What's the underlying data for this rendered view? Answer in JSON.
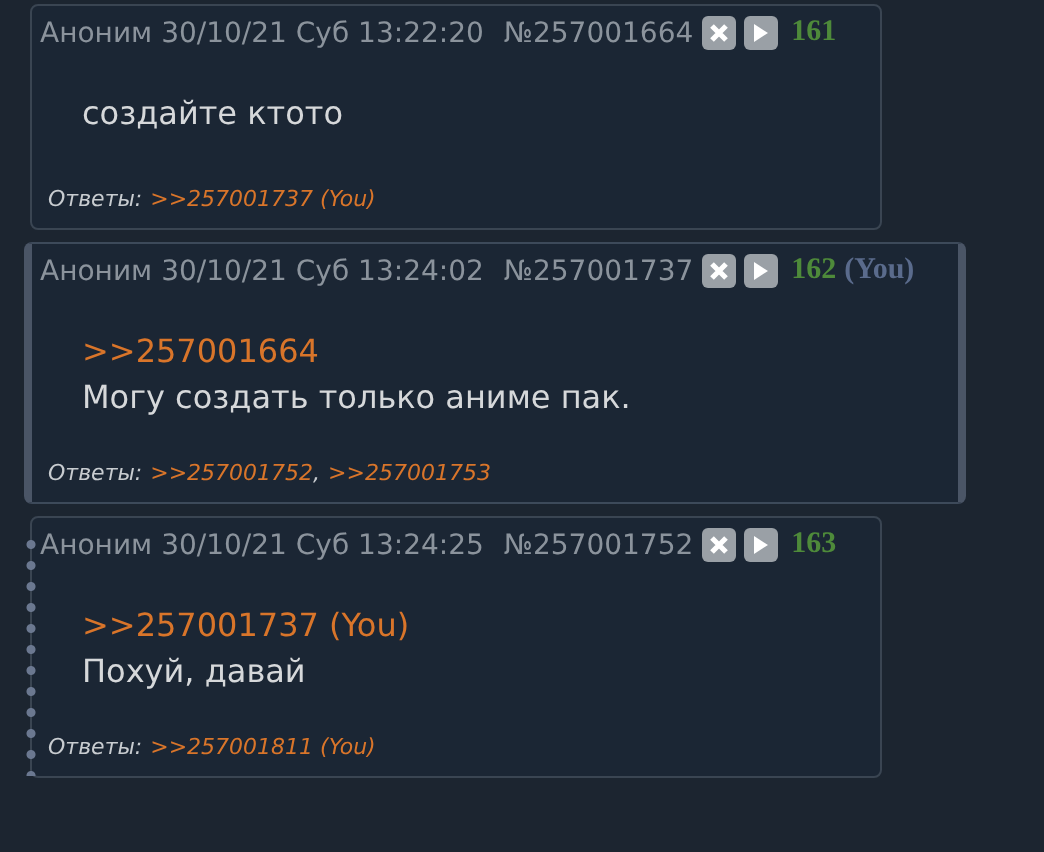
{
  "posts": [
    {
      "author": "Аноним",
      "datetime": "30/10/21 Суб 13:22:20",
      "number": "№257001664",
      "index": "161",
      "highlighted": false,
      "marked": false,
      "body": [
        {
          "kind": "text",
          "text": "создайте ктото"
        }
      ],
      "replies_label": "Ответы:",
      "replies": [
        ">>257001737 (You)"
      ]
    },
    {
      "author": "Аноним",
      "datetime": "30/10/21 Суб 13:24:02",
      "number": "№257001737",
      "index": "162",
      "you": "(You)",
      "highlighted": true,
      "marked": false,
      "body": [
        {
          "kind": "quote",
          "text": ">>257001664"
        },
        {
          "kind": "text",
          "text": "Могу создать только аниме пак."
        }
      ],
      "replies_label": "Ответы:",
      "replies_separator": ",",
      "replies": [
        ">>257001752",
        ">>257001753"
      ]
    },
    {
      "author": "Аноним",
      "datetime": "30/10/21 Суб 13:24:25",
      "number": "№257001752",
      "index": "163",
      "highlighted": false,
      "marked": true,
      "body": [
        {
          "kind": "quote",
          "text": ">>257001737 (You)"
        },
        {
          "kind": "text",
          "text": "Похуй, давай"
        }
      ],
      "replies_label": "Ответы:",
      "replies": [
        ">>257001811 (You)"
      ]
    }
  ]
}
